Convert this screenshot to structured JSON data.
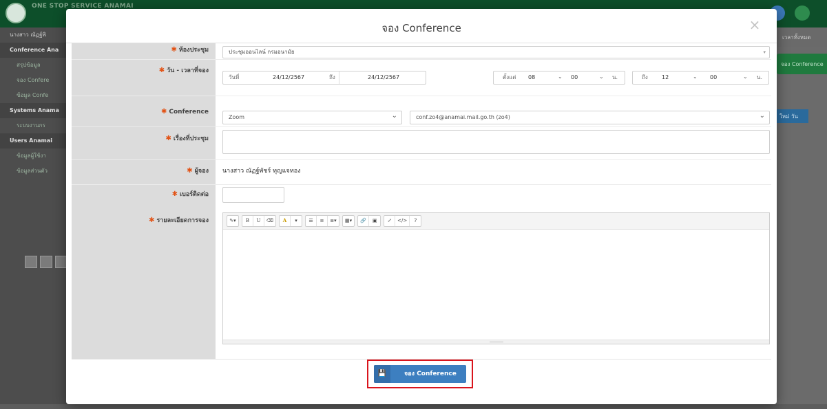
{
  "background": {
    "app_title": "ONE STOP SERVICE ANAMAI",
    "user_name": "นางสาว ณัฏฐ์พิ",
    "sidebar": [
      {
        "label": "Conference Ana",
        "type": "head"
      },
      {
        "label": "สรุปข้อมูล",
        "type": "sub"
      },
      {
        "label": "จอง Confere",
        "type": "sub"
      },
      {
        "label": "ข้อมูล Confe",
        "type": "sub"
      },
      {
        "label": "Systems Anama",
        "type": "head"
      },
      {
        "label": "ระบบงานกร",
        "type": "sub"
      },
      {
        "label": "Users Anamai",
        "type": "head"
      },
      {
        "label": "ข้อมูลผู้ใช้งา",
        "type": "sub"
      },
      {
        "label": "ข้อมูลส่วนตัว",
        "type": "sub"
      }
    ],
    "right_top_text": "เวลาทั้งหมด",
    "right_button": "จอง Conference",
    "right_small_button": "ใหม่  วัน"
  },
  "modal": {
    "title": "จอง Conference",
    "close": "×"
  },
  "form": {
    "room": {
      "label": "ห้องประชุม",
      "value": "ประชุมออนไลน์ กรมอนามัย"
    },
    "datetime": {
      "label": "วัน - เวลาที่จอง",
      "date_from_prefix": "วันที่",
      "date_from": "24/12/2567",
      "date_to_prefix": "ถึง",
      "date_to": "24/12/2567",
      "time_from_prefix": "ตั้งแต่",
      "time_from_hour": "08",
      "time_from_min": "00",
      "unit": "น.",
      "time_to_prefix": "ถึง",
      "time_to_hour": "12",
      "time_to_min": "00"
    },
    "conference": {
      "label": "Conference",
      "platform": "Zoom",
      "account": "conf.zo4@anamai.mail.go.th (zo4)"
    },
    "topic": {
      "label": "เรื่องที่ประชุม",
      "value": ""
    },
    "booker": {
      "label": "ผู้จอง",
      "value": "นางสาว ณัฏฐ์พัชร์ ทุญแจทอง"
    },
    "phone": {
      "label": "เบอร์ติดต่อ",
      "value": ""
    },
    "details": {
      "label": "รายละเอียดการจอง",
      "toolbar": [
        "✎▾",
        "B",
        "U",
        "⌫",
        "A",
        "▾",
        "☰",
        "≡",
        "≣▾",
        "▦▾",
        "🔗",
        "▣",
        "⤢",
        "</>",
        "?"
      ]
    }
  },
  "submit": {
    "icon": "floppy-disk-icon",
    "label": "จอง Conference"
  }
}
